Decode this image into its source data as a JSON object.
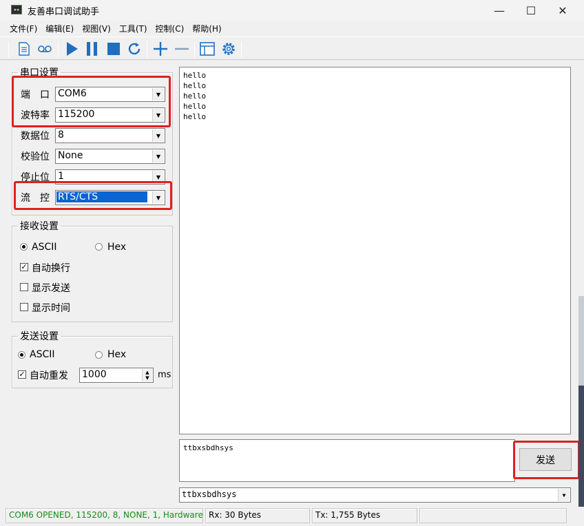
{
  "window": {
    "title": "友善串口调试助手",
    "minimize_glyph": "—",
    "maximize_glyph": "☐",
    "close_glyph": "✕"
  },
  "menu": [
    "文件(F)",
    "编辑(E)",
    "视图(V)",
    "工具(T)",
    "控制(C)",
    "帮助(H)"
  ],
  "toolbar": {
    "icons": [
      "new-document-icon",
      "loop-icon",
      "play-icon",
      "pause-icon",
      "stop-icon",
      "refresh-icon",
      "plus-icon",
      "minus-icon",
      "window-icon",
      "settings-icon"
    ]
  },
  "serial": {
    "group_title": "串口设置",
    "port_label": "端　口",
    "port_value": "COM6",
    "baud_label": "波特率",
    "baud_value": "115200",
    "databits_label": "数据位",
    "databits_value": "8",
    "parity_label": "校验位",
    "parity_value": "None",
    "stopbits_label": "停止位",
    "stopbits_value": "1",
    "flow_label": "流　控",
    "flow_value": "RTS/CTS"
  },
  "receive": {
    "group_title": "接收设置",
    "ascii_label": "ASCII",
    "hex_label": "Hex",
    "mode_selected": "ASCII",
    "auto_newline_label": "自动换行",
    "auto_newline_checked": true,
    "show_send_label": "显示发送",
    "show_send_checked": false,
    "show_time_label": "显示时间",
    "show_time_checked": false
  },
  "send": {
    "group_title": "发送设置",
    "ascii_label": "ASCII",
    "hex_label": "Hex",
    "mode_selected": "ASCII",
    "auto_resend_label": "自动重发",
    "auto_resend_checked": true,
    "interval_value": "1000",
    "interval_unit": "ms"
  },
  "receive_text": "hello\nhello\nhello\nhello\nhello",
  "send_text": "ttbxsbdhsys",
  "send_button_label": "发送",
  "history_value": "ttbxsbdhsys",
  "status": {
    "connection": "COM6 OPENED, 115200, 8, NONE, 1, Hardware",
    "connection_color": "#1a8a1a",
    "rx": "Rx: 30 Bytes",
    "tx": "Tx: 1,755 Bytes"
  },
  "colors": {
    "highlight_box": "#e02020",
    "selection": "#0a64d2",
    "toolbar_icon": "#1f6fbf"
  }
}
